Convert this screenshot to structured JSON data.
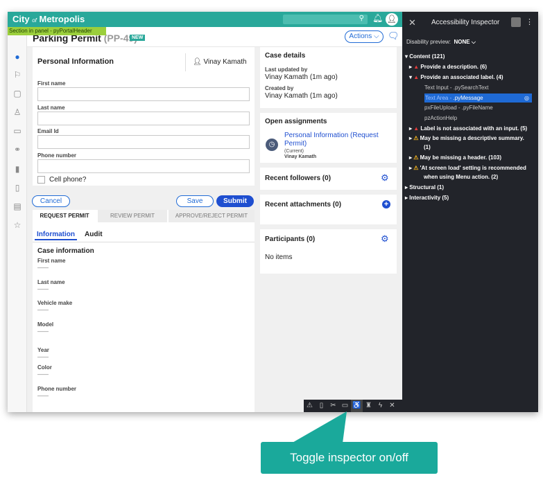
{
  "app": {
    "brand_city": "City",
    "brand_of": "of",
    "brand_metropolis": "Metropolis",
    "section_tag": "Section in panel - pyPortalHeader"
  },
  "case": {
    "title": "Parking Permit",
    "case_id": "(PP-49)",
    "new_badge": "NEW",
    "actions_label": "Actions ⌵"
  },
  "form": {
    "heading": "Personal Information",
    "assignee": "Vinay Kamath",
    "fields": [
      {
        "label": "First name",
        "value": ""
      },
      {
        "label": "Last name",
        "value": ""
      },
      {
        "label": "Email Id",
        "value": ""
      },
      {
        "label": "Phone number",
        "value": ""
      }
    ],
    "checkbox_label": "Cell phone?",
    "cancel": "Cancel",
    "save": "Save",
    "submit": "Submit"
  },
  "stages": [
    "REQUEST PERMIT",
    "REVIEW PERMIT",
    "APPROVE/REJECT PERMIT"
  ],
  "tabs": [
    "Information",
    "Audit"
  ],
  "case_info": {
    "heading": "Case information",
    "fields": [
      {
        "label": "First name",
        "value": "——"
      },
      {
        "label": "Last name",
        "value": "——"
      },
      {
        "label": "Vehicle make",
        "value": "——"
      },
      {
        "label": "Model",
        "value": "——"
      },
      {
        "label": "Year",
        "value": "——"
      },
      {
        "label": "Color",
        "value": "——"
      },
      {
        "label": "Phone number",
        "value": "——"
      }
    ]
  },
  "case_details": {
    "heading": "Case details",
    "updated_label": "Last updated by",
    "updated_value": "Vinay Kamath (1m ago)",
    "created_label": "Created by",
    "created_value": "Vinay Kamath (1m ago)"
  },
  "assignments": {
    "heading": "Open assignments",
    "link": "Personal Information (Request Permit)",
    "status": "(Current)",
    "owner": "Vinay Kamath"
  },
  "followers": {
    "heading": "Recent followers (0)"
  },
  "attachments": {
    "heading": "Recent attachments (0)"
  },
  "participants": {
    "heading": "Participants (0)",
    "empty": "No items"
  },
  "inspector": {
    "title": "Accessibility Inspector",
    "disability_label": "Disability preview:",
    "disability_value": "NONE ⌵",
    "tree": [
      "Content (121)",
      "Provide a description. (6)",
      "Provide an associated label. (4)",
      "Text Input - .pySearchText",
      "Text Area - .pyMessage",
      "pxFileUpload - .pyFileName",
      "pzActionHelp",
      "Label is not associated with an input. (5)",
      "May be missing a descriptive summary.",
      "(1)",
      "May be missing a header. (103)",
      "'At screen load' setting is recommended",
      "when using Menu action. (2)",
      "Structural (1)",
      "Interactivity (5)"
    ]
  },
  "callout": {
    "text": "Toggle inspector on/off"
  },
  "colors": {
    "teal": "#29a89a",
    "blue": "#1f6ad5",
    "panel_dark": "#22242a",
    "section_tag": "#9bcf3c"
  }
}
